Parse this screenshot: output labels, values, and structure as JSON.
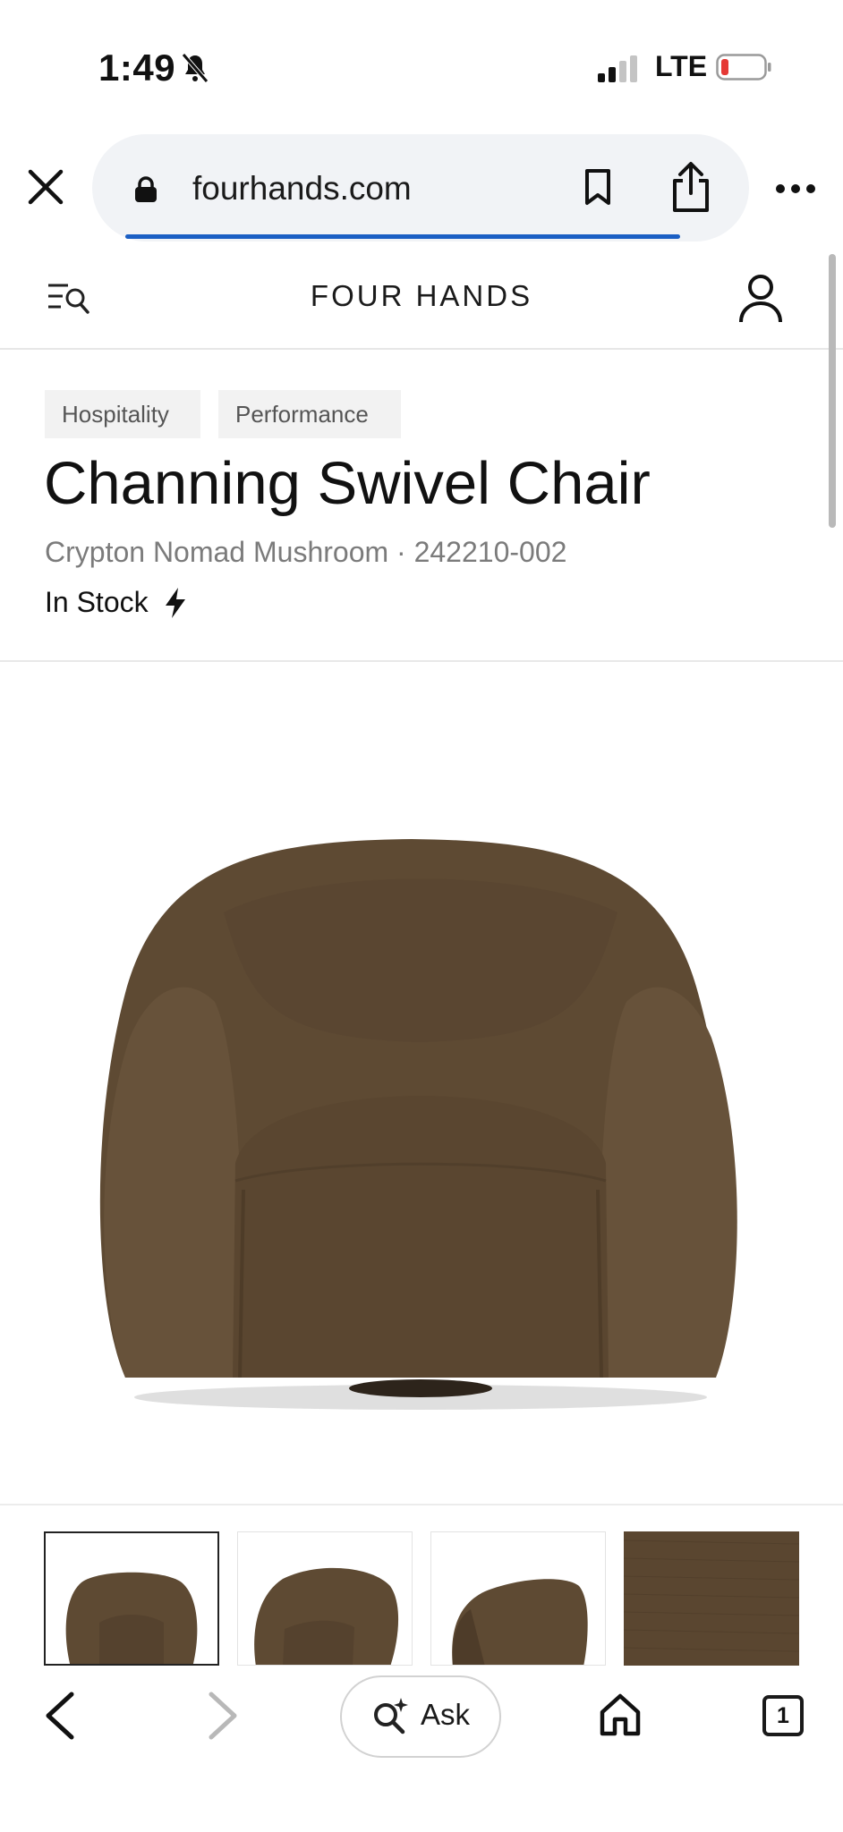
{
  "status_bar": {
    "time": "1:49",
    "network": "LTE",
    "icons": [
      "bell-slash-icon",
      "signal-icon",
      "battery-low-icon"
    ],
    "battery_color": "#e53935"
  },
  "browser": {
    "url": "fourhands.com",
    "accent": "#1b5fc4",
    "icons": [
      "close-icon",
      "lock-icon",
      "bookmark-icon",
      "share-icon",
      "more-icon"
    ]
  },
  "site_header": {
    "brand": "FOUR HANDS",
    "icons": [
      "menu-search-icon",
      "account-icon"
    ]
  },
  "product": {
    "tags": [
      "Hospitality",
      "Performance"
    ],
    "title": "Channing Swivel Chair",
    "variant": "Crypton Nomad Mushroom · 242210-002",
    "stock": "In Stock",
    "stock_icon": "lightning-bolt-icon",
    "fabric_color": "#5a4630"
  },
  "bottom_toolbar": {
    "ask_label": "Ask",
    "tab_count": "1",
    "icons": [
      "back-icon",
      "forward-icon",
      "ask-sparkle-icon",
      "home-icon",
      "tabs-icon"
    ]
  }
}
